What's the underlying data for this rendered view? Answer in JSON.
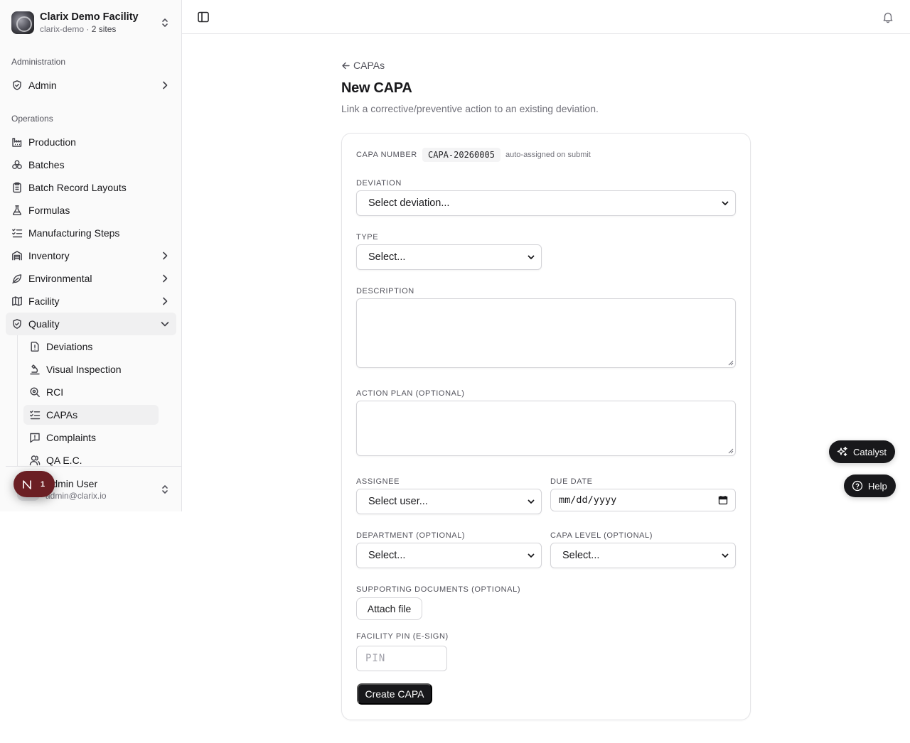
{
  "org": {
    "name": "Clarix Demo Facility",
    "slug": "clarix-demo",
    "separator": " · ",
    "sites": "2 sites"
  },
  "nav": {
    "administration_label": "Administration",
    "admin": "Admin",
    "operations_label": "Operations",
    "items": [
      {
        "label": "Production",
        "icon": "factory-icon"
      },
      {
        "label": "Batches",
        "icon": "boxes-icon"
      },
      {
        "label": "Batch Record Layouts",
        "icon": "clipboard-icon"
      },
      {
        "label": "Formulas",
        "icon": "flask-icon"
      },
      {
        "label": "Manufacturing Steps",
        "icon": "list-checks-icon"
      },
      {
        "label": "Inventory",
        "icon": "warehouse-icon"
      },
      {
        "label": "Environmental",
        "icon": "leaf-icon"
      },
      {
        "label": "Facility",
        "icon": "map-icon"
      },
      {
        "label": "Quality",
        "icon": "shield-check-icon"
      }
    ],
    "quality_sub": [
      {
        "label": "Deviations",
        "icon": "file-alert-icon"
      },
      {
        "label": "Visual Inspection",
        "icon": "microscope-icon"
      },
      {
        "label": "RCI",
        "icon": "search-zoom-icon"
      },
      {
        "label": "CAPAs",
        "icon": "list-checks-icon"
      },
      {
        "label": "Complaints",
        "icon": "message-alert-icon"
      },
      {
        "label": "QA E.C.",
        "icon": "users-icon"
      }
    ]
  },
  "user": {
    "name": "Admin User",
    "email": "admin@clarix.io"
  },
  "devtool": {
    "letter": "N",
    "count": "1"
  },
  "page": {
    "back": "CAPAs",
    "title": "New CAPA",
    "description": "Link a corrective/preventive action to an existing deviation."
  },
  "form": {
    "capa_number_label": "CAPA NUMBER",
    "capa_number": "CAPA-20260005",
    "capa_auto": "auto-assigned on submit",
    "deviation_label": "DEVIATION",
    "deviation_value": "Select deviation...",
    "type_label": "TYPE",
    "type_value": "Select...",
    "description_label": "DESCRIPTION",
    "action_plan_label": "ACTION PLAN (OPTIONAL)",
    "assignee_label": "ASSIGNEE",
    "assignee_value": "Select user...",
    "due_date_label": "DUE DATE",
    "due_date_value": "mm/dd/yyyy",
    "department_label": "DEPARTMENT (OPTIONAL)",
    "department_value": "Select...",
    "capa_level_label": "CAPA LEVEL (OPTIONAL)",
    "capa_level_value": "Select...",
    "supporting_docs_label": "SUPPORTING DOCUMENTS (OPTIONAL)",
    "attach_label": "Attach file",
    "pin_label": "FACILITY PIN (E-SIGN)",
    "pin_placeholder": "PIN",
    "submit_label": "Create CAPA"
  },
  "floating": {
    "catalyst": "Catalyst",
    "help": "Help"
  }
}
